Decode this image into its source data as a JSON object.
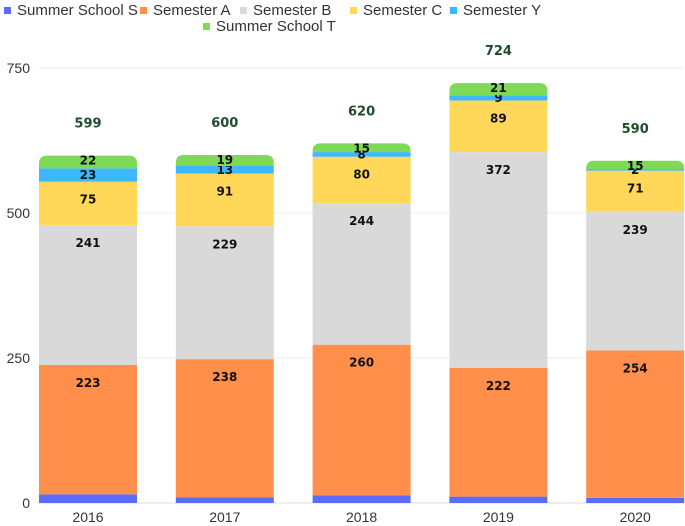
{
  "chart_data": {
    "type": "bar",
    "stacked": true,
    "title": "",
    "xlabel": "",
    "ylabel": "",
    "categories": [
      "2016",
      "2017",
      "2018",
      "2019",
      "2020"
    ],
    "ylim": [
      0,
      750
    ],
    "yticks": [
      0,
      250,
      500,
      750
    ],
    "grid": true,
    "legend_position": "top-center",
    "series": [
      {
        "name": "Summer School S",
        "color": "#5b6cf9",
        "values": [
          15,
          10,
          13,
          11,
          9
        ]
      },
      {
        "name": "Semester A",
        "color": "#ff8f4a",
        "values": [
          223,
          238,
          260,
          222,
          254
        ]
      },
      {
        "name": "Semester B",
        "color": "#d9d9d9",
        "values": [
          241,
          229,
          244,
          372,
          239
        ]
      },
      {
        "name": "Semester C",
        "color": "#ffd85a",
        "values": [
          75,
          91,
          80,
          89,
          71
        ]
      },
      {
        "name": "Semester Y",
        "color": "#3db8ff",
        "values": [
          23,
          13,
          8,
          9,
          2
        ]
      },
      {
        "name": "Summer School T",
        "color": "#7ed957",
        "values": [
          22,
          19,
          15,
          21,
          15
        ]
      }
    ],
    "totals": [
      599,
      600,
      620,
      724,
      590
    ]
  }
}
